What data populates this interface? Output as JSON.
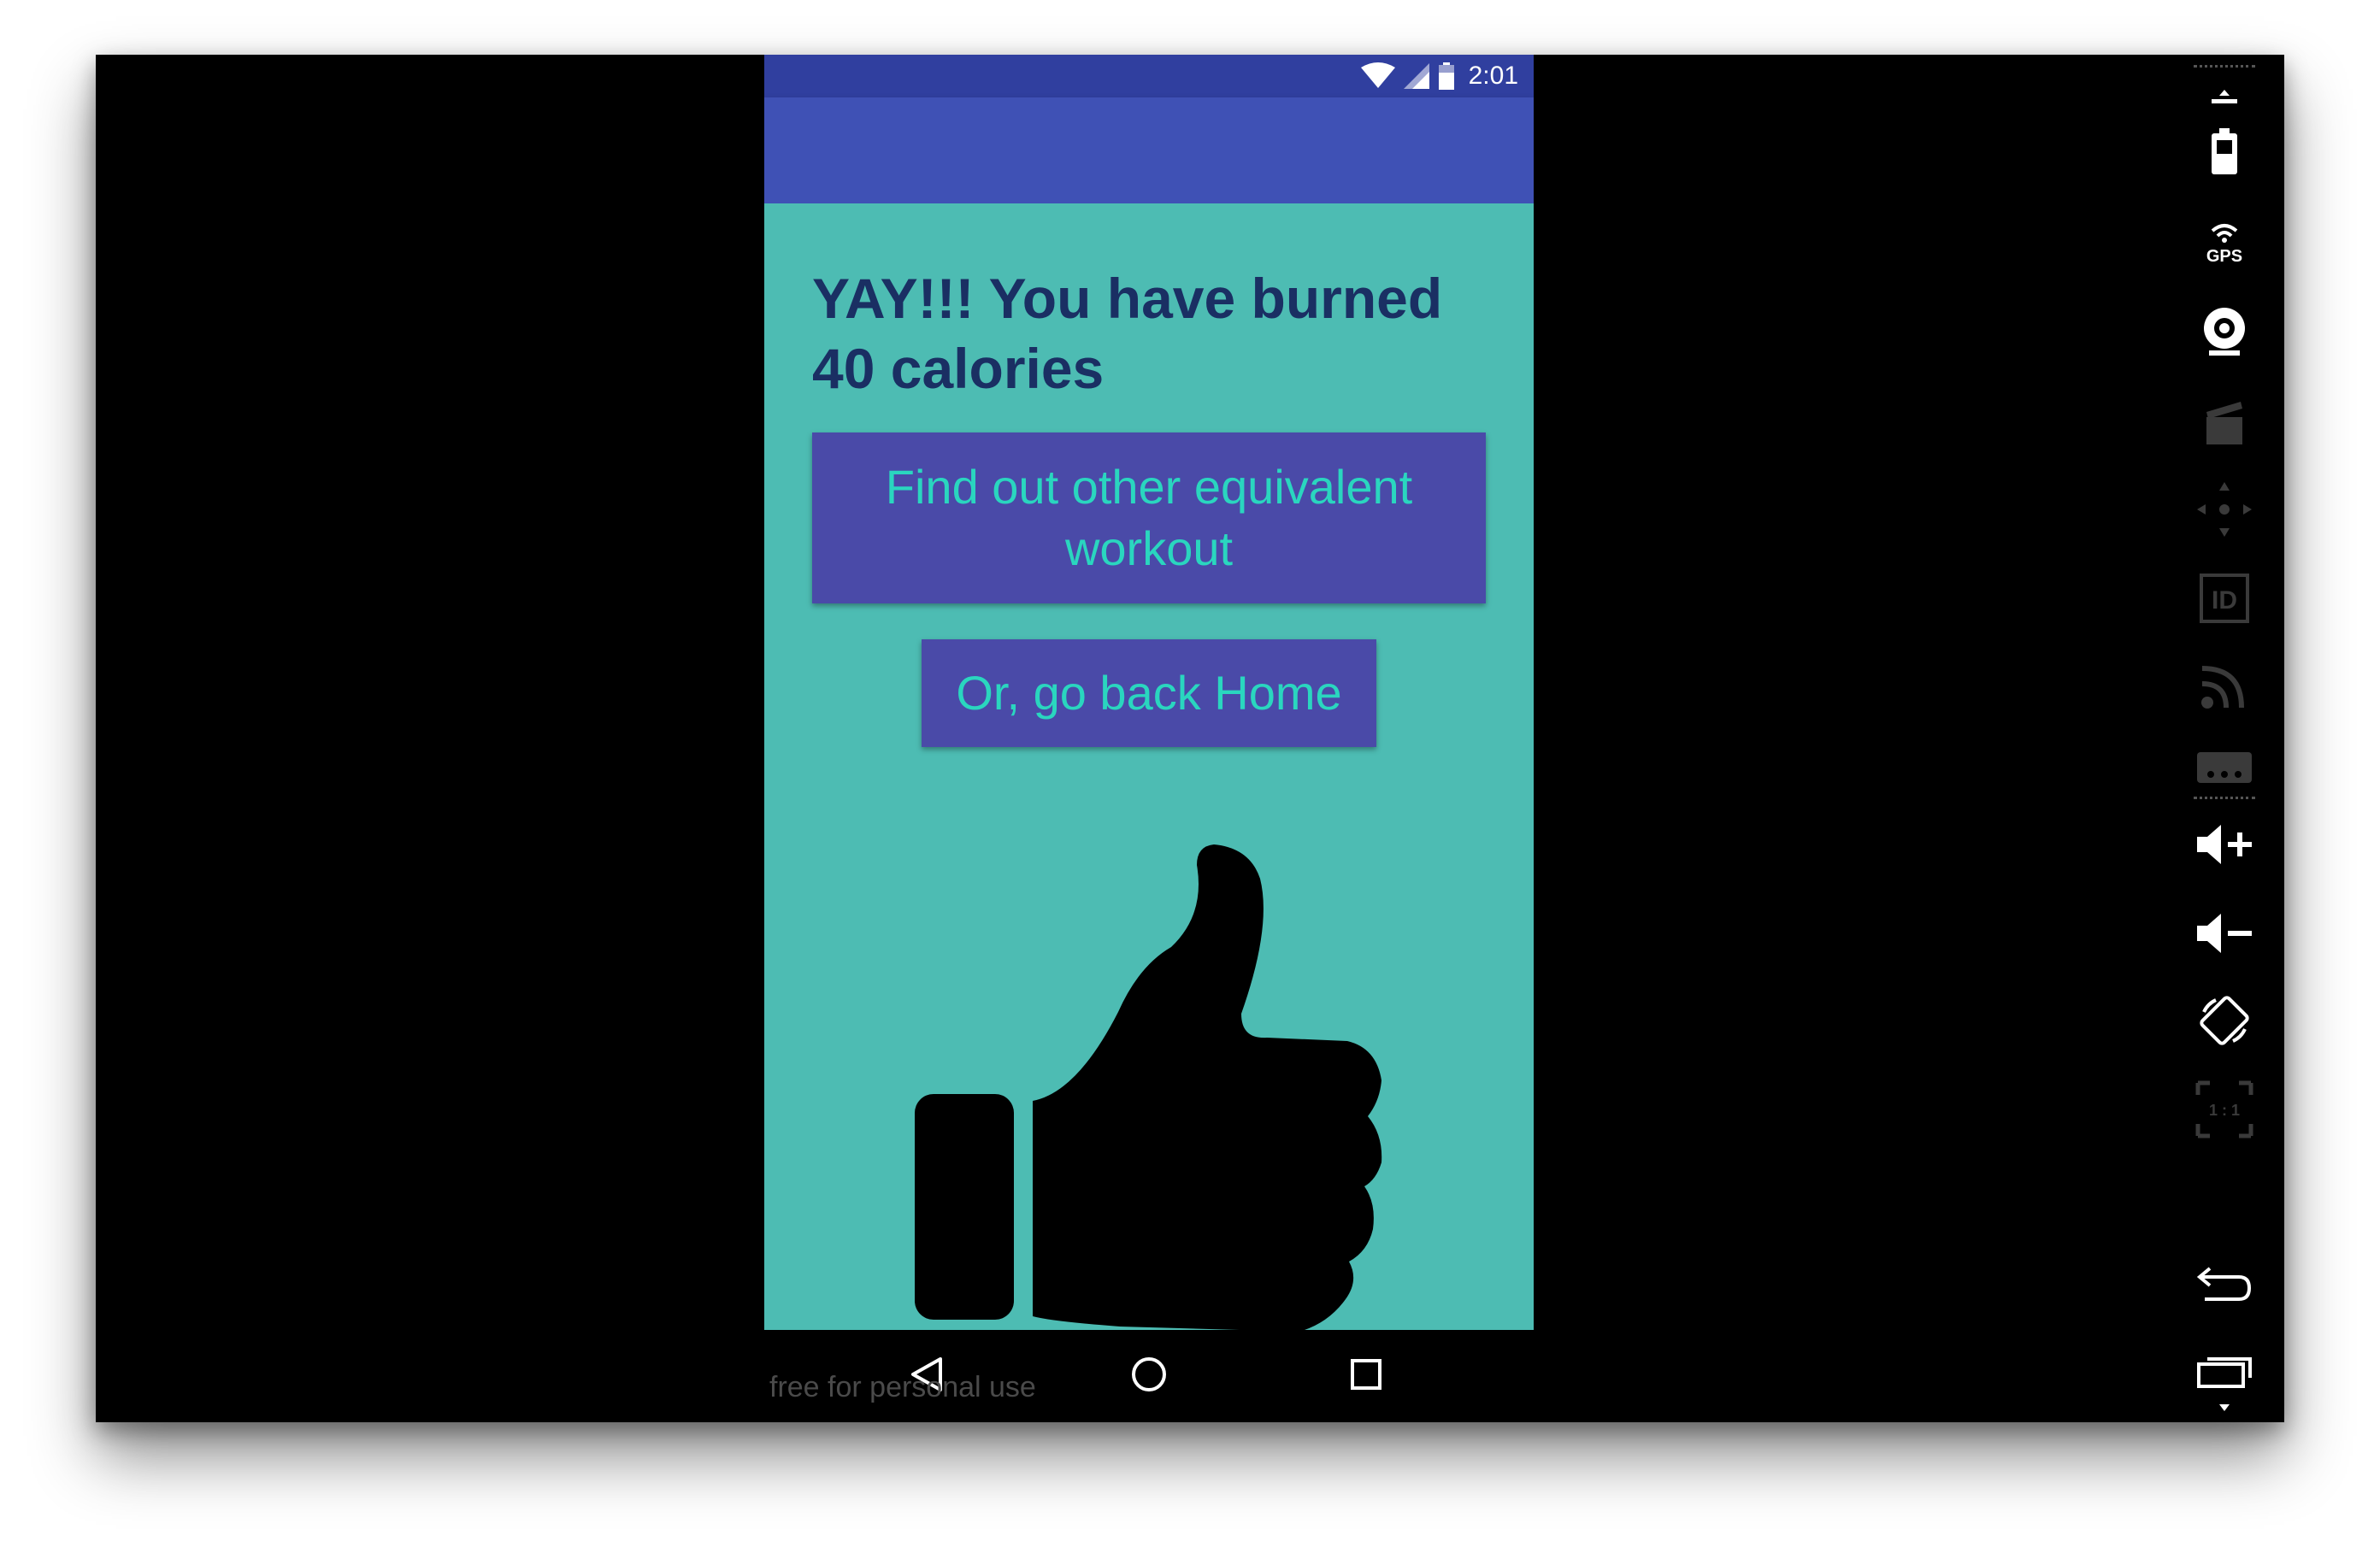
{
  "status_bar": {
    "time": "2:01",
    "icons": [
      "wifi-icon",
      "cell-signal-icon",
      "battery-icon"
    ]
  },
  "main": {
    "headline": "YAY!!! You have burned 40 calories",
    "equivalent_button_label": "Find out other equivalent workout",
    "home_button_label": "Or, go back Home",
    "image": "thumbs-up-icon"
  },
  "nav_bar": {
    "icons": [
      "back-icon",
      "home-icon",
      "recents-icon"
    ]
  },
  "watermark": "free for personal use",
  "emulator_toolbar": {
    "gps_label": "GPS",
    "id_label": "ID",
    "ratio_label": "1 : 1",
    "tools": [
      "battery-tool-icon",
      "gps-tool-icon",
      "camera-tool-icon",
      "media-tool-icon",
      "dpad-tool-icon",
      "identity-tool-icon",
      "network-tool-icon",
      "sms-tool-icon",
      "volume-up-icon",
      "volume-down-icon",
      "rotate-icon",
      "scale-icon",
      "back-tool-icon",
      "recents-tool-icon"
    ]
  },
  "colors": {
    "status_bar": "#303f9f",
    "app_bar": "#3f51b5",
    "content_bg": "#4dbcb3",
    "headline_text": "#1a2f63",
    "button_bg": "#4a4aa8",
    "button_text": "#2ad6bf"
  }
}
